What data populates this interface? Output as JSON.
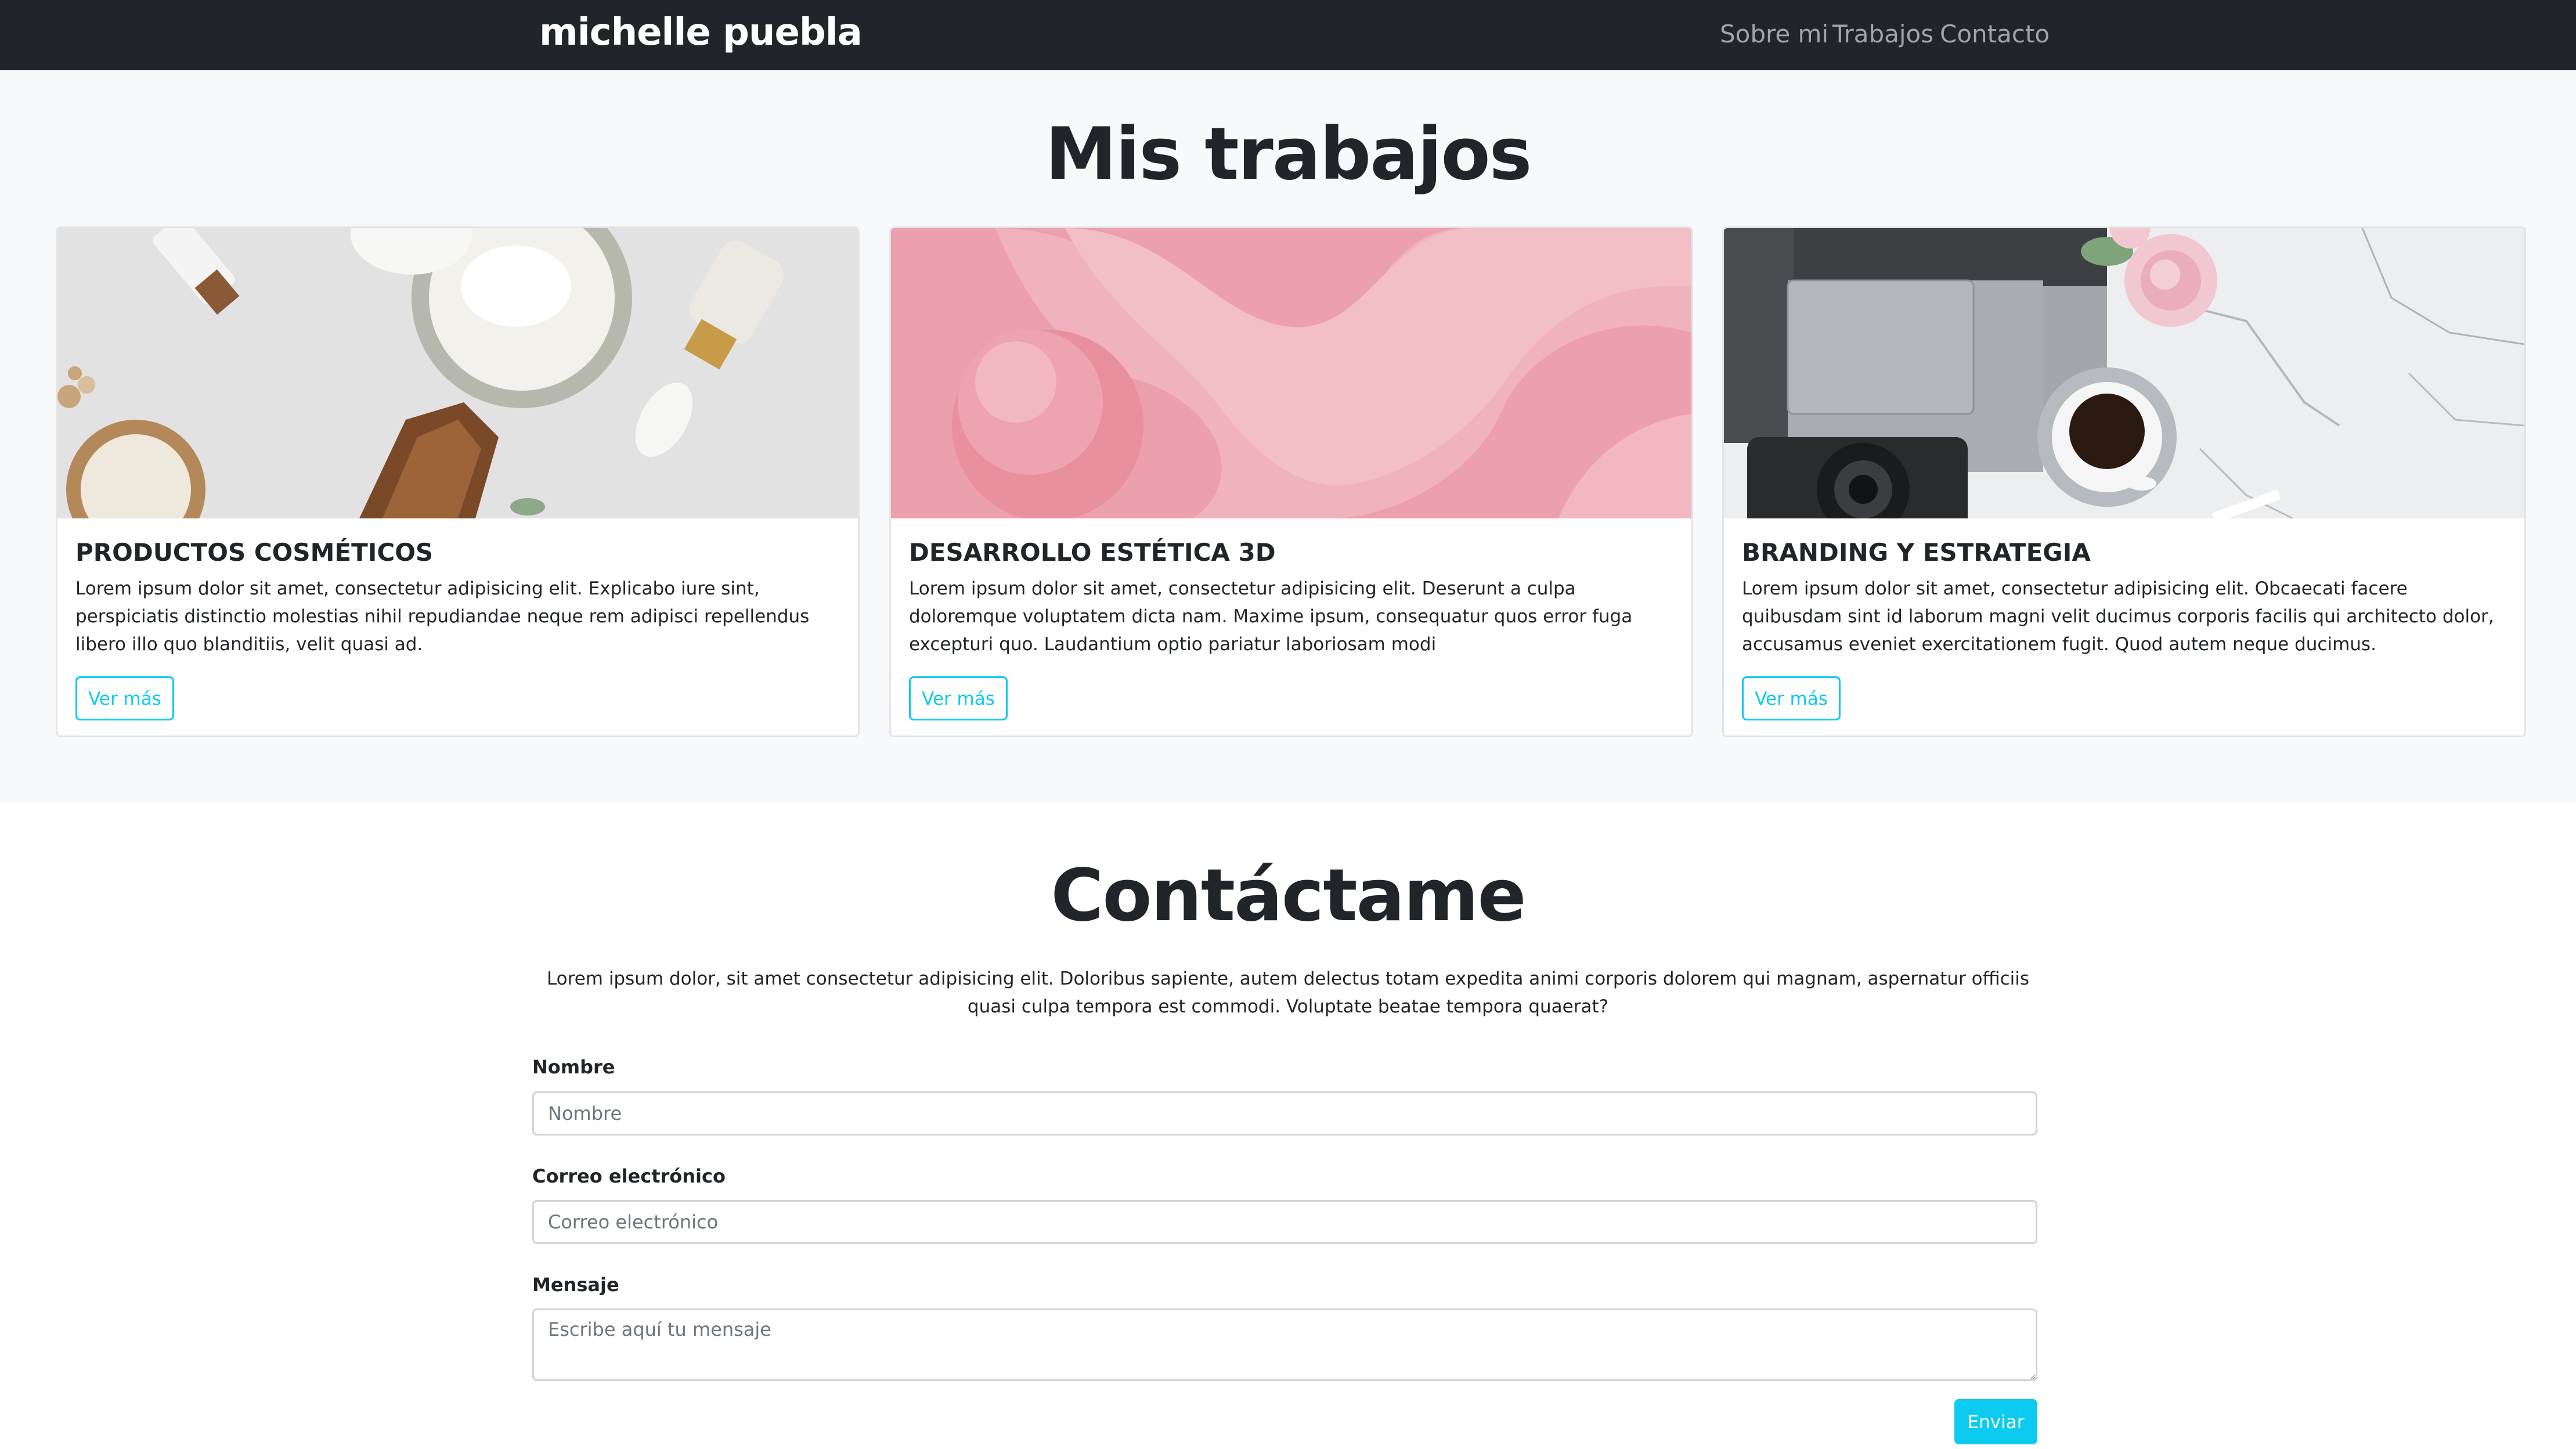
{
  "navbar": {
    "brand": "michelle puebla",
    "links": [
      "Sobre mi",
      "Trabajos",
      "Contacto"
    ]
  },
  "works": {
    "title": "Mis trabajos",
    "cards": [
      {
        "image": "cosmetics-photo",
        "title": "PRODUCTOS COSMÉTICOS",
        "text": "Lorem ipsum dolor sit amet, consectetur adipisicing elit. Explicabo iure sint, perspiciatis distinctio molestias nihil repudiandae neque rem adipisci repellendus libero illo quo blanditiis, velit quasi ad.",
        "button": "Ver más"
      },
      {
        "image": "pink-3d-shapes-photo",
        "title": "DESARROLLO ESTÉTICA 3D",
        "text": "Lorem ipsum dolor sit amet, consectetur adipisicing elit. Deserunt a culpa doloremque voluptatem dicta nam. Maxime ipsum, consequatur quos error fuga excepturi quo. Laudantium optio pariatur laboriosam modi",
        "button": "Ver más"
      },
      {
        "image": "laptop-coffee-desk-photo",
        "title": "BRANDING Y ESTRATEGIA",
        "text": "Lorem ipsum dolor sit amet, consectetur adipisicing elit. Obcaecati facere quibusdam sint id laborum magni velit ducimus corporis facilis qui architecto dolor, accusamus eveniet exercitationem fugit. Quod autem neque ducimus.",
        "button": "Ver más"
      }
    ]
  },
  "contact": {
    "title": "Contáctame",
    "text": "Lorem ipsum dolor, sit amet consectetur adipisicing elit. Doloribus sapiente, autem delectus totam expedita animi corporis dolorem qui magnam, aspernatur officiis quasi culpa tempora est commodi. Voluptate beatae tempora quaerat?",
    "name_label": "Nombre",
    "name_placeholder": "Nombre",
    "email_label": "Correo electrónico",
    "email_placeholder": "Correo electrónico",
    "message_label": "Mensaje",
    "message_placeholder": "Escribe aquí tu mensaje",
    "submit": "Enviar"
  },
  "colors": {
    "navbar_bg": "#212529",
    "section_bg": "#f8f9fa",
    "accent": "#0dcaf0"
  }
}
